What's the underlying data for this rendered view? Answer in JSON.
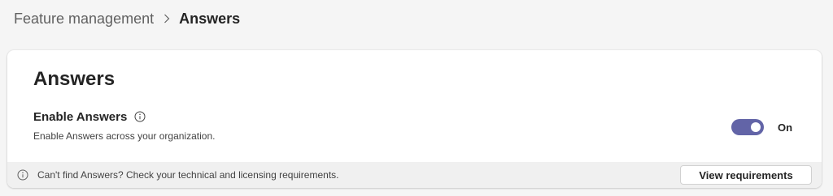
{
  "breadcrumb": {
    "parent": "Feature management",
    "separator_icon": "chevron-right-icon",
    "current": "Answers"
  },
  "card": {
    "title": "Answers",
    "setting": {
      "label": "Enable Answers",
      "info_icon": "info-icon",
      "description": "Enable Answers across your organization.",
      "toggle_state": "On",
      "toggle_on": true,
      "toggle_color": "#6264a7"
    },
    "footer": {
      "info_icon": "info-icon",
      "message": "Can't find Answers? Check your technical and licensing requirements.",
      "button_label": "View requirements"
    }
  }
}
